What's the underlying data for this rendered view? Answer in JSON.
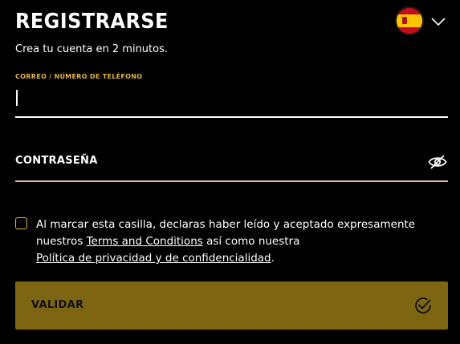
{
  "header": {
    "title": "REGISTRARSE",
    "subtitle": "Crea tu cuenta en 2 minutos."
  },
  "language": {
    "flag_icon": "spain-flag-icon",
    "chevron_icon": "chevron-down-icon"
  },
  "email": {
    "label": "CORREO / NÚMERO DE TELÉFONO",
    "value": ""
  },
  "password": {
    "label": "CONTRASEÑA",
    "value": "",
    "toggle_icon": "eye-icon"
  },
  "consent": {
    "text_1": "Al marcar esta casilla, declaras haber leído y aceptado expresamente nuestros ",
    "terms_link": "Terms and Conditions",
    "text_2": " así como nuestra ",
    "privacy_link": "Política de privacidad y de confidencialidad",
    "text_3": ".",
    "checked": false
  },
  "submit": {
    "label": "VALIDAR",
    "icon": "check-circle-icon"
  },
  "colors": {
    "accent": "#e2b53e",
    "button_bg": "#7e6512",
    "background": "#000000"
  }
}
